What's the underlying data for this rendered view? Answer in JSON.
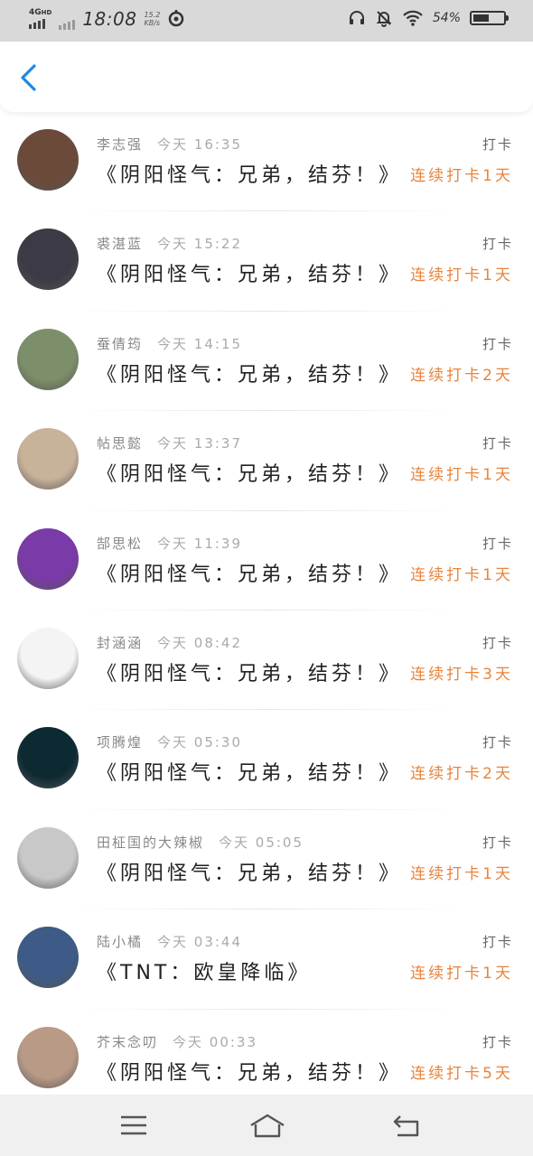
{
  "status_bar": {
    "network": "4G",
    "hd": "HD",
    "time": "18:08",
    "speed_value": "15.2",
    "speed_unit": "KB/s",
    "battery_percent": "54%",
    "battery_level": 0.54
  },
  "items": [
    {
      "name": "李志强",
      "time": "今天 16:35",
      "type": "打卡",
      "title": "《阴阳怪气：兄弟，结芬！》",
      "streak": "连续打卡1天"
    },
    {
      "name": "裘湛蓝",
      "time": "今天 15:22",
      "type": "打卡",
      "title": "《阴阳怪气：兄弟，结芬！》",
      "streak": "连续打卡1天"
    },
    {
      "name": "蚕倩筠",
      "time": "今天 14:15",
      "type": "打卡",
      "title": "《阴阳怪气：兄弟，结芬！》",
      "streak": "连续打卡2天"
    },
    {
      "name": "帖思懿",
      "time": "今天 13:37",
      "type": "打卡",
      "title": "《阴阳怪气：兄弟，结芬！》",
      "streak": "连续打卡1天"
    },
    {
      "name": "郜思松",
      "time": "今天 11:39",
      "type": "打卡",
      "title": "《阴阳怪气：兄弟，结芬！》",
      "streak": "连续打卡1天"
    },
    {
      "name": "封涵涵",
      "time": "今天 08:42",
      "type": "打卡",
      "title": "《阴阳怪气：兄弟，结芬！》",
      "streak": "连续打卡3天"
    },
    {
      "name": "项腾煌",
      "time": "今天 05:30",
      "type": "打卡",
      "title": "《阴阳怪气：兄弟，结芬！》",
      "streak": "连续打卡2天"
    },
    {
      "name": "田柾国的大辣椒",
      "time": "今天 05:05",
      "type": "打卡",
      "title": "《阴阳怪气：兄弟，结芬！》",
      "streak": "连续打卡1天"
    },
    {
      "name": "陆小橘",
      "time": "今天 03:44",
      "type": "打卡",
      "title": "《TNT：欧皇降临》",
      "streak": "连续打卡1天"
    },
    {
      "name": "芥末念叨",
      "time": "今天 00:33",
      "type": "打卡",
      "title": "《阴阳怪气：兄弟，结芬！》",
      "streak": "连续打卡5天"
    }
  ],
  "avatar_colors": [
    "#6b4a3a",
    "#3c3a44",
    "#7d8f6a",
    "#c9b29a",
    "#7a3aa8",
    "#f4f4f4",
    "#0d2a33",
    "#c8c8c8",
    "#3d5b86",
    "#b89a86"
  ],
  "colors": {
    "accent": "#1e88e5",
    "streak": "#e8843c"
  },
  "icons": {
    "back": "back-arrow-icon",
    "headphones": "headphones-icon",
    "mute": "bell-off-icon",
    "wifi": "wifi-icon",
    "loading": "loading-icon",
    "menu": "menu-icon",
    "home": "home-icon",
    "return": "return-icon"
  }
}
